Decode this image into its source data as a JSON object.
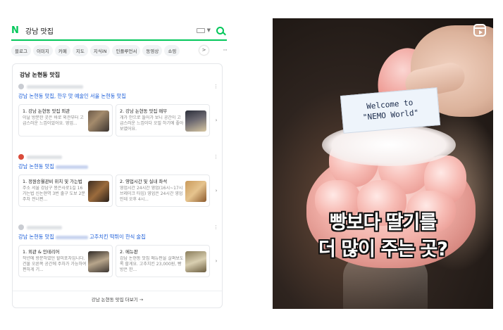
{
  "search": {
    "logo": "N",
    "query": "강남 맛집",
    "tabs": [
      "블로그",
      "이미지",
      "카페",
      "지도",
      "지식iN",
      "인플루언서",
      "동영상",
      "쇼핑"
    ],
    "more": "···",
    "scroll_arrow": ">"
  },
  "results": {
    "box_title": "강남 논현동 맛집",
    "entries": [
      {
        "title": "강남 논현동 맛집, 한우 맛 예술인 서울 논현동 맛집",
        "cards": [
          {
            "title": "1. 강남 논현동 맛집 외관",
            "text": "이날 방문한 곳은 바로 외관부터 고급스러운 느낌이었어요. 영업..."
          },
          {
            "title": "2. 강남 논현동 맛집 매부",
            "text": "개가 안으로 들어가 보니 공간이 고급스러운 느낌이다 오밀 하기에 좋아 보였어요."
          }
        ]
      },
      {
        "title": "강남 논현동 맛집",
        "cards": [
          {
            "title": "1. 정원승월관비 위치 및 가는법",
            "text": "주소 서울 강남구 봉은사로1길 16 가는법 신논현역 3번 출구 도보 2분 주차 전너편..."
          },
          {
            "title": "2. 영업시간 및 실내 좌석",
            "text": "영업시간 24시간 영업(16시~17시 브레이크 타임) 영업은 24시간 영업인데 오후 4시..."
          }
        ]
      },
      {
        "title_prefix": "강남 논현동 맛집",
        "title_suffix": "고추치킨 떡튀이 한식 술집",
        "cards": [
          {
            "title": "1. 외관 & 인테리어",
            "text": "작년에 방문하였던 할미포차입니다. 건물 오른쪽 공간에 주차가 가능하여 편하게 기..."
          },
          {
            "title": "2. 메뉴판",
            "text": "강남 논현동 맛집 메뉴판을 살펴보도록 할게요. 고추치킨 23,000원, 빵방은 한..."
          }
        ]
      }
    ],
    "more_link": "강남 논현동 맛집 더보기 →"
  },
  "reel": {
    "sign_line1": "Welcome to",
    "sign_line2": "\"NEMO World\"",
    "caption_line1": "빵보다 딸기를",
    "caption_line2": "더 많이 주는 곳?"
  }
}
